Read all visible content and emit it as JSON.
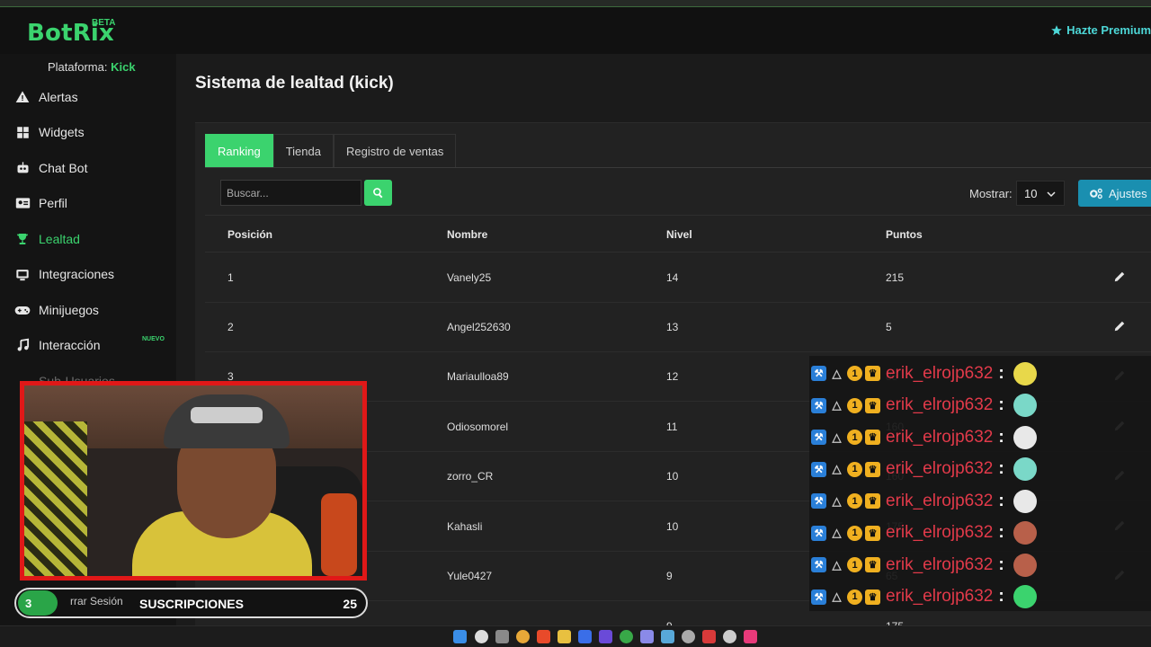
{
  "app": {
    "logo": "BotRix",
    "logo_badge": "BETA",
    "premium_label": "Hazte Premium"
  },
  "sidebar": {
    "platform_label": "Plataforma:",
    "platform_value": "Kick",
    "items": [
      {
        "label": "Alertas",
        "icon": "warning-icon"
      },
      {
        "label": "Widgets",
        "icon": "grid-icon"
      },
      {
        "label": "Chat Bot",
        "icon": "robot-icon"
      },
      {
        "label": "Perfil",
        "icon": "id-card-icon"
      },
      {
        "label": "Lealtad",
        "icon": "trophy-icon"
      },
      {
        "label": "Integraciones",
        "icon": "plug-icon"
      },
      {
        "label": "Minijuegos",
        "icon": "gamepad-icon"
      },
      {
        "label": "Interacción",
        "icon": "music-icon"
      }
    ],
    "nuevo_badge": "NUEVO",
    "partial_item": "Sub-Usuarios",
    "logout_partial": "rrar Sesión"
  },
  "page": {
    "title": "Sistema de lealtad (kick)"
  },
  "tabs": [
    "Ranking",
    "Tienda",
    "Registro de ventas"
  ],
  "search": {
    "placeholder": "Buscar..."
  },
  "show": {
    "label": "Mostrar:",
    "value": "10"
  },
  "ajustes_label": "Ajustes",
  "table": {
    "headers": [
      "Posición",
      "Nombre",
      "Nivel",
      "Puntos"
    ],
    "rows": [
      {
        "pos": "1",
        "name": "Vanely25",
        "level": "14",
        "points": "215"
      },
      {
        "pos": "2",
        "name": "Angel252630",
        "level": "13",
        "points": "5"
      },
      {
        "pos": "3",
        "name": "Mariaulloa89",
        "level": "12",
        "points": "85"
      },
      {
        "pos": "",
        "name": "Odiosomorel",
        "level": "11",
        "points": "160"
      },
      {
        "pos": "",
        "name": "zorro_CR",
        "level": "10",
        "points": "160"
      },
      {
        "pos": "",
        "name": "Kahasli",
        "level": "10",
        "points": "175"
      },
      {
        "pos": "",
        "name": "Yule0427",
        "level": "9",
        "points": "65"
      },
      {
        "pos": "",
        "name": "",
        "level": "9",
        "points": "175"
      }
    ]
  },
  "overlay": {
    "subs_count_left": "3",
    "subs_title": "SUSCRIPCIONES",
    "subs_count_right": "25",
    "chat": [
      {
        "user": "erik_elrojp632",
        "colon": ":",
        "emote_color": "#e8d84a"
      },
      {
        "user": "erik_elrojp632",
        "colon": ":",
        "emote_color": "#7ad8c8"
      },
      {
        "user": "erik_elrojp632",
        "colon": ":",
        "emote_color": "#e8e8e8"
      },
      {
        "user": "erik_elrojp632",
        "colon": ":",
        "emote_color": "#7ad8c8"
      },
      {
        "user": "erik_elrojp632",
        "colon": ":",
        "emote_color": "#e8e8e8"
      },
      {
        "user": "erik_elrojp632",
        "colon": ":",
        "emote_color": "#b8604a"
      },
      {
        "user": "erik_elrojp632",
        "colon": ":",
        "emote_color": "#b8604a"
      },
      {
        "user": "erik_elrojp632",
        "colon": ":",
        "emote_color": "#3bd36e"
      }
    ]
  },
  "colors": {
    "accent": "#3bd36e",
    "info": "#1a8fb0",
    "webcam_border": "#e01818",
    "chat_user": "#e23a4a"
  }
}
